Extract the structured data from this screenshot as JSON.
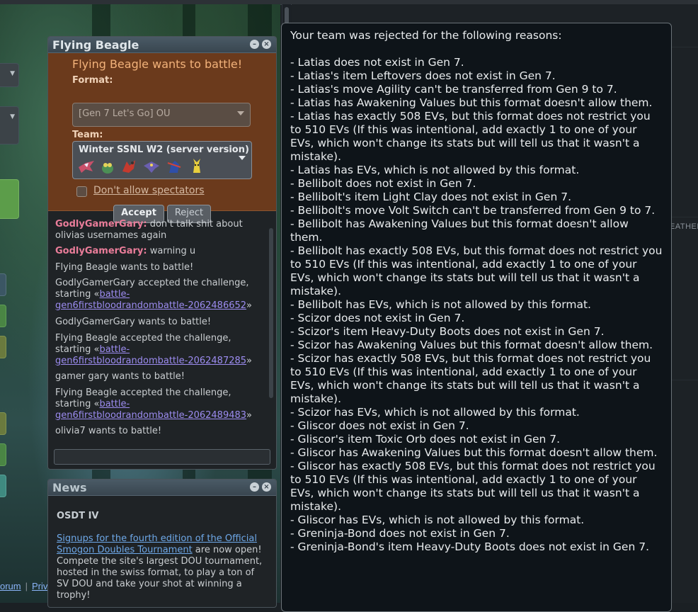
{
  "background": {
    "right_edge_label": "EATHER",
    "footer": {
      "forum": "orum",
      "separator": "|",
      "privacy": "Privacy policy"
    }
  },
  "pm_window": {
    "title": "Flying Beagle",
    "challenge": {
      "heading": "Flying Beagle wants to battle!",
      "format_label": "Format:",
      "format_value": "[Gen 7 Let's Go] OU",
      "team_label": "Team:",
      "team_value": "Winter SSNL W2 (server version)",
      "team_icons": [
        "latias-icon",
        "bellibolt-icon",
        "scizor-icon",
        "gliscor-icon",
        "greninja-icon",
        "pikachu-icon"
      ],
      "spectators_label": "Don't allow spectators",
      "accept_label": "Accept",
      "reject_label": "Reject"
    },
    "chat": [
      {
        "user": "GodlyGamerGary:",
        "text": " don't talk shit about olivias usernames again"
      },
      {
        "user": "GodlyGamerGary:",
        "text": " warning u"
      },
      {
        "text": "Flying Beagle wants to battle!"
      },
      {
        "text": "GodlyGamerGary accepted the challenge, starting «",
        "link": "battle-gen6firstbloodrandombattle-2062486652",
        "after": "»"
      },
      {
        "text": "GodlyGamerGary wants to battle!"
      },
      {
        "text": "Flying Beagle accepted the challenge, starting «",
        "link": "battle-gen6firstbloodrandombattle-2062487285",
        "after": "»"
      },
      {
        "text": "gamer gary wants to battle!"
      },
      {
        "text": "Flying Beagle accepted the challenge, starting «",
        "link": "battle-gen6firstbloodrandombattle-2062489483",
        "after": "»"
      },
      {
        "text": "olivia7 wants to battle!"
      }
    ]
  },
  "news_window": {
    "title": "News",
    "headline": "OSDT IV",
    "link_text": "Signups for the fourth edition of the Official Smogon Doubles Tournament",
    "body": " are now open! Compete the site's largest DOU tournament, hosted in the swiss format, to play a ton of SV DOU and take your shot at winning a trophy!"
  },
  "popup": {
    "lines": [
      "Your team was rejected for the following reasons:",
      "",
      "- Latias does not exist in Gen 7.",
      "- Latias's item Leftovers does not exist in Gen 7.",
      "- Latias's move Agility can't be transferred from Gen 9 to 7.",
      "- Latias has Awakening Values but this format doesn't allow them.",
      "- Latias has exactly 508 EVs, but this format does not restrict you to 510 EVs (If this was intentional, add exactly 1 to one of your EVs, which won't change its stats but will tell us that it wasn't a mistake).",
      "- Latias has EVs, which is not allowed by this format.",
      "- Bellibolt does not exist in Gen 7.",
      "- Bellibolt's item Light Clay does not exist in Gen 7.",
      "- Bellibolt's move Volt Switch can't be transferred from Gen 9 to 7.",
      "- Bellibolt has Awakening Values but this format doesn't allow them.",
      "- Bellibolt has exactly 508 EVs, but this format does not restrict you to 510 EVs (If this was intentional, add exactly 1 to one of your EVs, which won't change its stats but will tell us that it wasn't a mistake).",
      "- Bellibolt has EVs, which is not allowed by this format.",
      "- Scizor does not exist in Gen 7.",
      "- Scizor's item Heavy-Duty Boots does not exist in Gen 7.",
      "- Scizor has Awakening Values but this format doesn't allow them.",
      "- Scizor has exactly 508 EVs, but this format does not restrict you to 510 EVs (If this was intentional, add exactly 1 to one of your EVs, which won't change its stats but will tell us that it wasn't a mistake).",
      "- Scizor has EVs, which is not allowed by this format.",
      "- Gliscor does not exist in Gen 7.",
      "- Gliscor's item Toxic Orb does not exist in Gen 7.",
      "- Gliscor has Awakening Values but this format doesn't allow them.",
      "- Gliscor has exactly 508 EVs, but this format does not restrict you to 510 EVs (If this was intentional, add exactly 1 to one of your EVs, which won't change its stats but will tell us that it wasn't a mistake).",
      "- Gliscor has EVs, which is not allowed by this format.",
      "- Greninja-Bond does not exist in Gen 7.",
      "- Greninja-Bond's item Heavy-Duty Boots does not exist in Gen 7."
    ]
  }
}
